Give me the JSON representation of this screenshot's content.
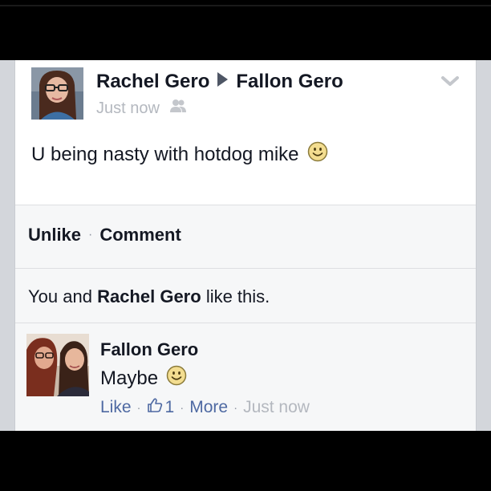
{
  "post": {
    "author": "Rachel Gero",
    "target": "Fallon Gero",
    "timestamp": "Just now",
    "audience_icon": "friends-icon",
    "options_icon": "chevron-down-icon",
    "text": "U being nasty with hotdog mike",
    "emoji": "smiley-icon"
  },
  "actions": {
    "unlike_label": "Unlike",
    "separator": "·",
    "comment_label": "Comment"
  },
  "likes": {
    "prefix": "You and",
    "name": "Rachel Gero",
    "suffix": "like this."
  },
  "comment": {
    "author": "Fallon Gero",
    "text": "Maybe",
    "emoji": "smiley-icon",
    "like_label": "Like",
    "like_count": "1",
    "more_label": "More",
    "timestamp": "Just now",
    "separator": "·"
  },
  "colors": {
    "text": "#141823",
    "muted": "#b4b8bf",
    "link": "#4e69a2",
    "panel": "#f6f7f8"
  }
}
